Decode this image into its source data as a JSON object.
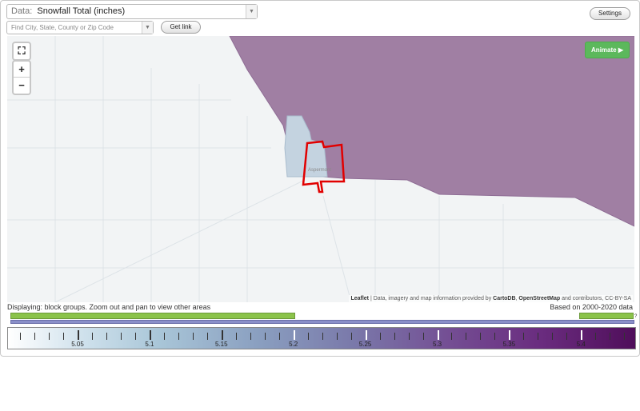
{
  "data_select": {
    "label": "Data:",
    "value": "Snowfall Total (inches)"
  },
  "search": {
    "placeholder": "Find City, State, County or Zip Code"
  },
  "buttons": {
    "get_link": "Get link",
    "settings": "Settings",
    "animate": "Animate ▶"
  },
  "zoom": {
    "fullscreen": "⛶",
    "zoom_in": "+",
    "zoom_out": "−"
  },
  "map": {
    "place_label": "Aspermont",
    "attribution_leaflet": "Leaflet",
    "attribution_text": " | Data, imagery and map information provided by ",
    "attribution_carto": "CartoDB",
    "attribution_sep": ", ",
    "attribution_osm": "OpenStreetMap",
    "attribution_tail": " and contributors, CC-BY-SA",
    "colors": {
      "purple_region": "#a07fa3",
      "light_region": "#c4d3e0",
      "highlight": "#e10000",
      "background": "#f2f4f5"
    }
  },
  "footer": {
    "displaying": "Displaying: block groups. Zoom out and pan to view other areas",
    "based_on": "Based on 2000-2020 data",
    "hist_question": "?"
  },
  "scale": {
    "labels": [
      "5.05",
      "5.1",
      "5.15",
      "5.2",
      "5.25",
      "5.3",
      "5.35",
      "5.4"
    ]
  }
}
